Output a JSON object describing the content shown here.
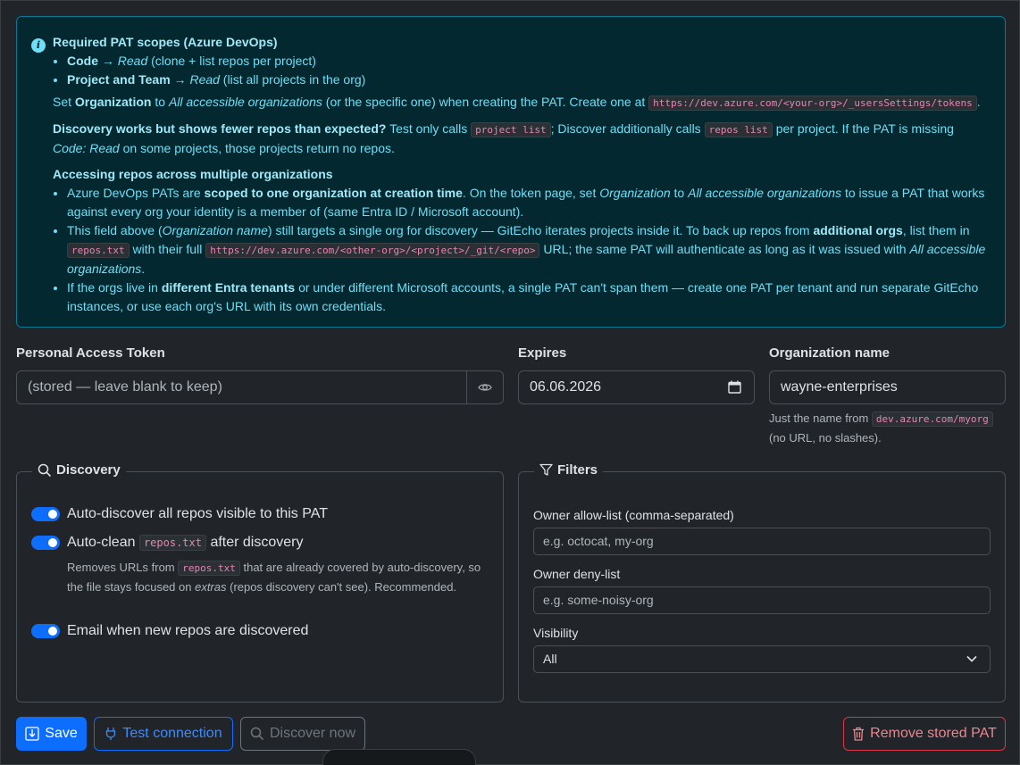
{
  "alert": {
    "title": "Required PAT scopes (Azure DevOps)",
    "scopes": [
      {
        "name": "Code",
        "arrow": " → ",
        "perm": "Read",
        "desc": " (clone + list repos per project)"
      },
      {
        "name": "Project and Team",
        "arrow": " → ",
        "perm": "Read",
        "desc": " (list all projects in the org)"
      }
    ],
    "set_org": {
      "prefix": "Set ",
      "org": "Organization",
      "to": " to ",
      "all": "All accessible organizations",
      "rest": " (or the specific one) when creating the PAT. Create one at ",
      "url": "https://dev.azure.com/<your-org>/_usersSettings/tokens",
      "end": "."
    },
    "discovery": {
      "bold": "Discovery works but shows fewer repos than expected?",
      "t1": " Test only calls ",
      "c1": "project list",
      "t2": "; Discover additionally calls ",
      "c2": "repos list",
      "t3": " per project. If the PAT is missing ",
      "em1": "Code: Read",
      "t4": " on some projects, those projects return no repos."
    },
    "multi_title": "Accessing repos across multiple organizations",
    "multi": {
      "b1_a": "Azure DevOps PATs are ",
      "b1_b": "scoped to one organization at creation time",
      "b1_c": ". On the token page, set ",
      "b1_d": "Organization",
      "b1_e": " to ",
      "b1_f": "All accessible organizations",
      "b1_g": " to issue a PAT that works against every org your identity is a member of (same Entra ID / Microsoft account).",
      "b2_a": "This field above (",
      "b2_b": "Organization name",
      "b2_c": ") still targets a single org for discovery — GitEcho iterates projects inside it. To back up repos from ",
      "b2_d": "additional orgs",
      "b2_e": ", list them in ",
      "b2_f": "repos.txt",
      "b2_g": " with their full ",
      "b2_h": "https://dev.azure.com/<other-org>/<project>/_git/<repo>",
      "b2_i": " URL; the same PAT will authenticate as long as it was issued with ",
      "b2_j": "All accessible organizations",
      "b2_k": ".",
      "b3_a": "If the orgs live in ",
      "b3_b": "different Entra tenants",
      "b3_c": " or under different Microsoft accounts, a single PAT can't span them — create one PAT per tenant and run separate GitEcho instances, or use each org's URL with its own credentials."
    }
  },
  "form": {
    "pat_label": "Personal Access Token",
    "pat_placeholder": "(stored — leave blank to keep)",
    "expires_label": "Expires",
    "expires_value": "06.06.2026",
    "org_label": "Organization name",
    "org_value": "wayne-enterprises",
    "org_hint_a": "Just the name from ",
    "org_hint_code": "dev.azure.com/myorg",
    "org_hint_b": "(no URL, no slashes)."
  },
  "discovery": {
    "legend": "Discovery",
    "auto_discover": "Auto-discover all repos visible to this PAT",
    "auto_clean_a": "Auto-clean",
    "auto_clean_code": "repos.txt",
    "auto_clean_b": "after discovery",
    "help_a": "Removes URLs from ",
    "help_code": "repos.txt",
    "help_b": " that are already covered by auto-discovery, so the file stays focused on ",
    "help_em": "extras",
    "help_c": " (repos discovery can't see). Recommended.",
    "email": "Email when new repos are discovered"
  },
  "filters": {
    "legend": "Filters",
    "allow_label": "Owner allow-list (comma-separated)",
    "allow_placeholder": "e.g. octocat, my-org",
    "deny_label": "Owner deny-list",
    "deny_placeholder": "e.g. some-noisy-org",
    "visibility_label": "Visibility",
    "visibility_value": "All"
  },
  "buttons": {
    "save": "Save",
    "test": "Test connection",
    "discover": "Discover now",
    "remove": "Remove stored PAT"
  },
  "colors": {
    "primary": "#0d6efd",
    "danger": "#dc3545",
    "info_bg": "#032830",
    "info_text": "#6edff6"
  }
}
